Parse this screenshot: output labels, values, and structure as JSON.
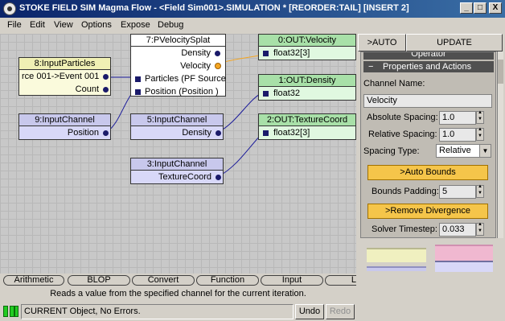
{
  "window": {
    "title": "STOKE FIELD SIM Magma Flow - <Field Sim001>.SIMULATION * [REORDER:TAIL] [INSERT 2]",
    "controls": [
      "_",
      "□",
      "X"
    ]
  },
  "menu": [
    "File",
    "Edit",
    "View",
    "Options",
    "Expose",
    "Debug"
  ],
  "nodes": {
    "velocity_splat": {
      "title": "7:PVelocitySplat",
      "outputs": [
        "Density",
        "Velocity"
      ],
      "inputs": [
        "Particles (PF Source",
        "Position (Position )"
      ]
    },
    "input_particles": {
      "title": "8:InputParticles",
      "rows": [
        "rce 001->Event 001",
        "Count"
      ]
    },
    "input_channel_9": {
      "title": "9:InputChannel",
      "output": "Position"
    },
    "input_channel_5": {
      "title": "5:InputChannel",
      "output": "Density"
    },
    "input_channel_3": {
      "title": "3:InputChannel",
      "output": "TextureCoord"
    },
    "out_velocity": {
      "title": "0:OUT:Velocity",
      "input": "float32[3]"
    },
    "out_density": {
      "title": "1:OUT:Density",
      "input": "float32"
    },
    "out_texcoord": {
      "title": "2:OUT:TextureCoord",
      "input": "float32[3]"
    }
  },
  "panel": {
    "tab_auto": ">AUTO",
    "tab_update": "UPDATE",
    "rollout_operator": "Operator",
    "rollout_properties": "Properties and Actions",
    "channel_name_label": "Channel Name:",
    "channel_name_value": "Velocity",
    "abs_spacing_label": "Absolute Spacing:",
    "abs_spacing_value": "1.0",
    "rel_spacing_label": "Relative Spacing:",
    "rel_spacing_value": "1.0",
    "spacing_type_label": "Spacing Type:",
    "spacing_type_value": "Relative",
    "auto_bounds_button": ">Auto Bounds",
    "bounds_padding_label": "Bounds Padding:",
    "bounds_padding_value": "5",
    "remove_divergence_button": ">Remove Divergence",
    "solver_timestep_label": "Solver Timestep:",
    "solver_timestep_value": "0.033"
  },
  "categories": [
    "Arithmetic",
    "BLOP",
    "Convert",
    "Function",
    "Input",
    "Lo"
  ],
  "description": "Reads a value from the specified channel for the current iteration.",
  "status": {
    "text": "CURRENT Object, No Errors.",
    "undo": "Undo",
    "redo": "Redo"
  },
  "colors": {
    "node_input": "#d8d8f8",
    "node_particles": "#fafadc",
    "node_output": "#e0f8e0",
    "action_button": "#f5c54a",
    "wire": "#1a1a9a"
  }
}
